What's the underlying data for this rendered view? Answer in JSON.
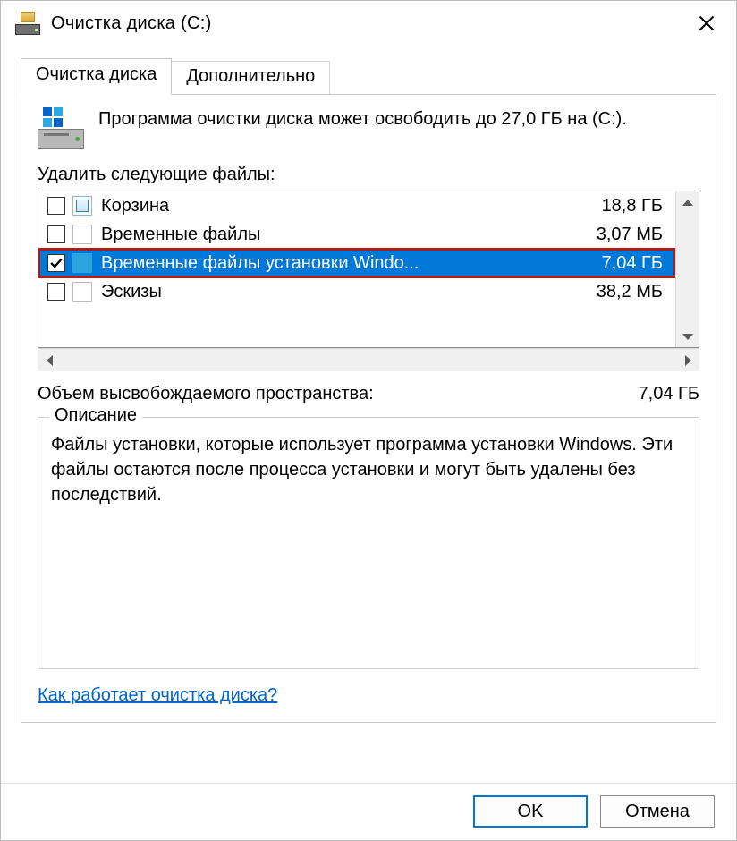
{
  "window": {
    "title": "Очистка диска  (C:)"
  },
  "tabs": {
    "cleanup": "Очистка диска",
    "more": "Дополнительно"
  },
  "info": {
    "text": "Программа очистки диска может освободить до 27,0 ГБ на  (C:)."
  },
  "list": {
    "label": "Удалить следующие файлы:",
    "items": [
      {
        "checked": false,
        "icon": "bin",
        "name": "Корзина",
        "size": "18,8 ГБ",
        "selected": false
      },
      {
        "checked": false,
        "icon": "file",
        "name": "Временные файлы",
        "size": "3,07 МБ",
        "selected": false
      },
      {
        "checked": true,
        "icon": "folder",
        "name": "Временные файлы установки Windo...",
        "size": "7,04 ГБ",
        "selected": true
      },
      {
        "checked": false,
        "icon": "file",
        "name": "Эскизы",
        "size": "38,2 МБ",
        "selected": false
      }
    ]
  },
  "freed": {
    "label": "Объем высвобождаемого пространства:",
    "value": "7,04 ГБ"
  },
  "description": {
    "legend": "Описание",
    "text": "Файлы установки, которые использует программа установки Windows.  Эти файлы остаются после процесса установки и могут быть удалены без последствий."
  },
  "help_link": "Как работает очистка диска?",
  "buttons": {
    "ok": "OK",
    "cancel": "Отмена"
  }
}
